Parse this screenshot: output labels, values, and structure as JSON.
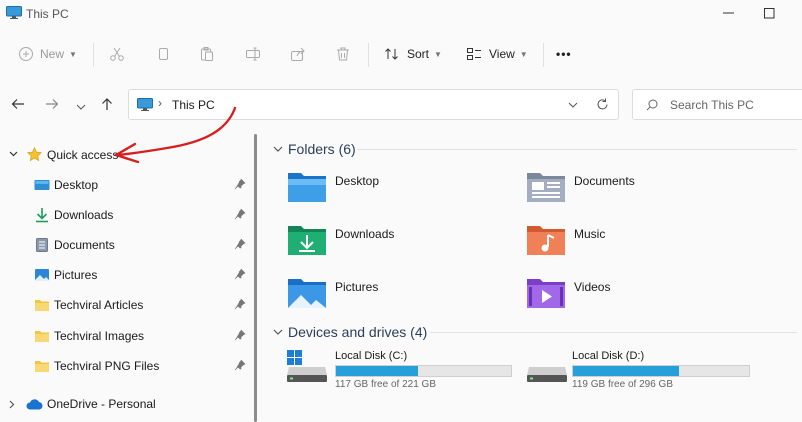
{
  "window": {
    "title": "This PC"
  },
  "toolbar": {
    "new_label": "New",
    "sort_label": "Sort",
    "view_label": "View",
    "more_label": "•••"
  },
  "address": {
    "path": "This PC"
  },
  "search": {
    "placeholder": "Search This PC"
  },
  "sidebar": {
    "quick_access": "Quick access",
    "items": [
      {
        "label": "Desktop",
        "icon": "desktop-icon"
      },
      {
        "label": "Downloads",
        "icon": "downloads-icon"
      },
      {
        "label": "Documents",
        "icon": "documents-icon"
      },
      {
        "label": "Pictures",
        "icon": "pictures-icon"
      },
      {
        "label": "Techviral Articles",
        "icon": "folder-icon"
      },
      {
        "label": "Techviral Images",
        "icon": "folder-icon"
      },
      {
        "label": "Techviral PNG Files",
        "icon": "folder-icon"
      }
    ],
    "onedrive": "OneDrive - Personal"
  },
  "main": {
    "folders_header": "Folders (6)",
    "folders": [
      {
        "label": "Desktop"
      },
      {
        "label": "Documents"
      },
      {
        "label": "Downloads"
      },
      {
        "label": "Music"
      },
      {
        "label": "Pictures"
      },
      {
        "label": "Videos"
      }
    ],
    "drives_header": "Devices and drives (4)",
    "drives": [
      {
        "label": "Local Disk (C:)",
        "free": "117 GB free of 221 GB",
        "used_fraction": 0.47
      },
      {
        "label": "Local Disk (D:)",
        "free": "119 GB free of 296 GB",
        "used_fraction": 0.6
      }
    ]
  },
  "colors": {
    "accent": "#26a0da",
    "annotation_arrow": "#d62020",
    "star": "#f2c230"
  }
}
